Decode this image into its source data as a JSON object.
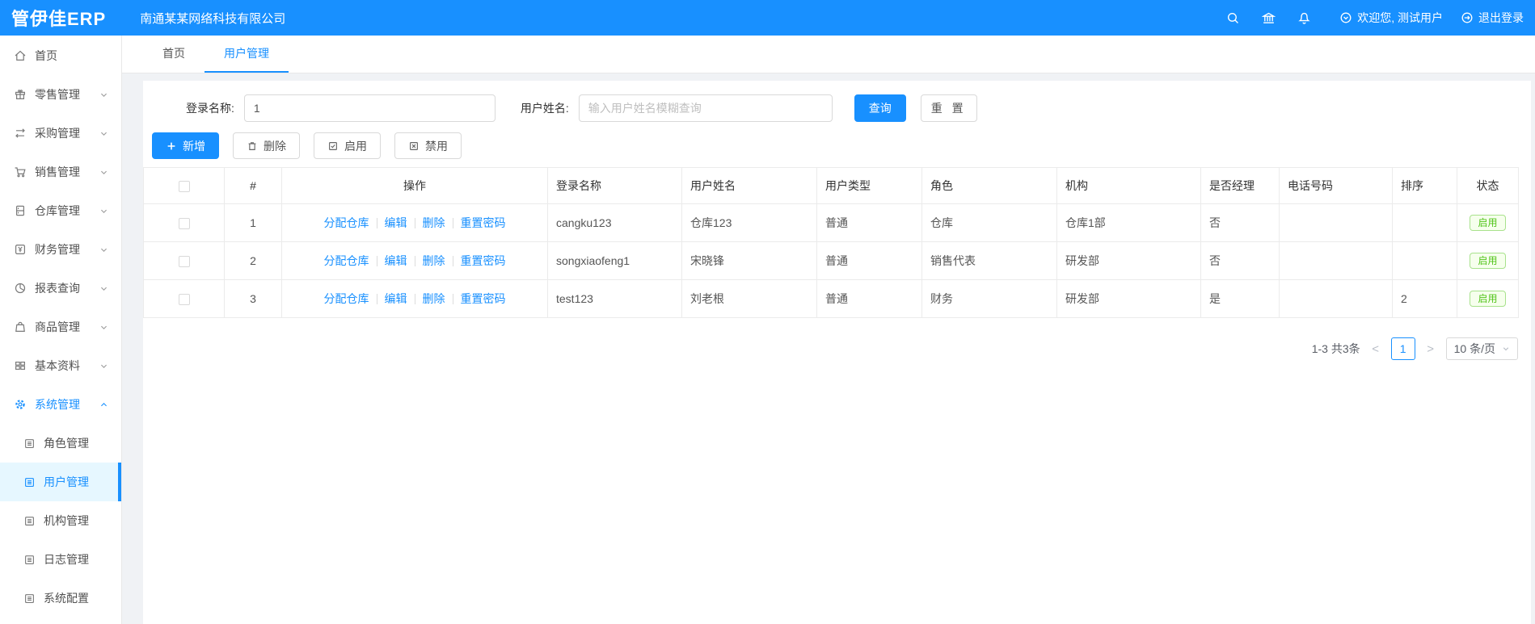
{
  "header": {
    "logo": "管伊佳ERP",
    "company": "南通某某网络科技有限公司",
    "welcome": "欢迎您, 测试用户",
    "logout": "退出登录",
    "accent_color": "#1890ff",
    "icons": [
      "search-icon",
      "bank-icon",
      "bell-icon",
      "circle-chevron-down-icon",
      "logout-icon"
    ]
  },
  "sidebar": {
    "items": [
      {
        "label": "首页",
        "icon": "home-icon",
        "expandable": false
      },
      {
        "label": "零售管理",
        "icon": "retail-icon",
        "expandable": true
      },
      {
        "label": "采购管理",
        "icon": "purchase-icon",
        "expandable": true
      },
      {
        "label": "销售管理",
        "icon": "sales-cart-icon",
        "expandable": true
      },
      {
        "label": "仓库管理",
        "icon": "warehouse-icon",
        "expandable": true
      },
      {
        "label": "财务管理",
        "icon": "finance-icon",
        "expandable": true
      },
      {
        "label": "报表查询",
        "icon": "report-pie-icon",
        "expandable": true
      },
      {
        "label": "商品管理",
        "icon": "goods-bag-icon",
        "expandable": true
      },
      {
        "label": "基本资料",
        "icon": "basic-grid-icon",
        "expandable": true
      },
      {
        "label": "系统管理",
        "icon": "gear-icon",
        "expandable": true,
        "expanded": true,
        "active": true
      }
    ],
    "subitems": [
      {
        "label": "角色管理",
        "active": false
      },
      {
        "label": "用户管理",
        "active": true
      },
      {
        "label": "机构管理",
        "active": false
      },
      {
        "label": "日志管理",
        "active": false
      },
      {
        "label": "系统配置",
        "active": false
      }
    ]
  },
  "tabs": [
    {
      "label": "首页",
      "active": false
    },
    {
      "label": "用户管理",
      "active": true
    }
  ],
  "filter": {
    "login_label": "登录名称:",
    "login_value": "1",
    "name_label": "用户姓名:",
    "name_placeholder": "输入用户姓名模糊查询",
    "search_button": "查询",
    "reset_button": "重 置"
  },
  "toolbar": {
    "add": "新增",
    "delete": "删除",
    "enable": "启用",
    "disable": "禁用"
  },
  "table": {
    "headers": [
      "#",
      "操作",
      "登录名称",
      "用户姓名",
      "用户类型",
      "角色",
      "机构",
      "是否经理",
      "电话号码",
      "排序",
      "状态"
    ],
    "ops": [
      "分配仓库",
      "编辑",
      "删除",
      "重置密码"
    ],
    "rows": [
      {
        "index": "1",
        "login": "cangku123",
        "name": "仓库123",
        "type": "普通",
        "role": "仓库",
        "org": "仓库1部",
        "manager": "否",
        "phone": "",
        "sort": "",
        "status": "启用"
      },
      {
        "index": "2",
        "login": "songxiaofeng1",
        "name": "宋晓锋",
        "type": "普通",
        "role": "销售代表",
        "org": "研发部",
        "manager": "否",
        "phone": "",
        "sort": "",
        "status": "启用"
      },
      {
        "index": "3",
        "login": "test123",
        "name": "刘老根",
        "type": "普通",
        "role": "财务",
        "org": "研发部",
        "manager": "是",
        "phone": "",
        "sort": "2",
        "status": "启用"
      }
    ],
    "status_color": "#52c41a"
  },
  "pagination": {
    "total": "1-3 共3条",
    "page": "1",
    "page_size": "10 条/页"
  }
}
